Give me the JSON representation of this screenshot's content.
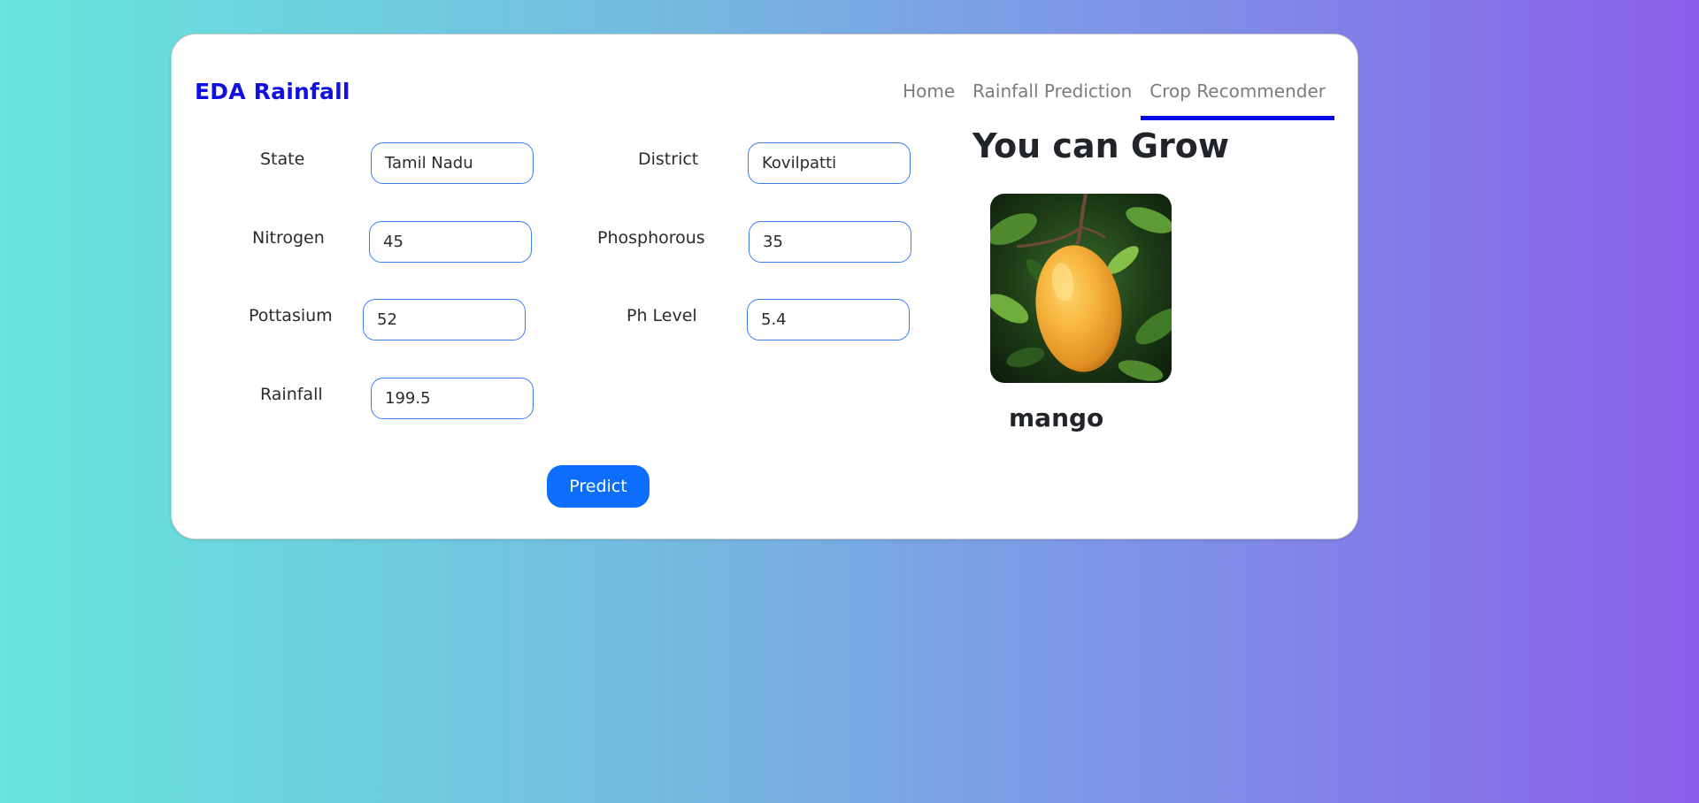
{
  "brand": "EDA Rainfall",
  "nav": {
    "items": [
      {
        "label": "Home"
      },
      {
        "label": "Rainfall Prediction"
      },
      {
        "label": "Crop Recommender"
      }
    ],
    "active": "Crop Recommender"
  },
  "form": {
    "state": {
      "label": "State",
      "value": "Tamil Nadu"
    },
    "district": {
      "label": "District",
      "value": "Kovilpatti"
    },
    "nitrogen": {
      "label": "Nitrogen",
      "value": "45"
    },
    "phosphorous": {
      "label": "Phosphorous",
      "value": "35"
    },
    "pottasium": {
      "label": "Pottasium",
      "value": "52"
    },
    "ph_level": {
      "label": "Ph Level",
      "value": "5.4"
    },
    "rainfall": {
      "label": "Rainfall",
      "value": "199.5"
    },
    "submit_label": "Predict"
  },
  "result": {
    "heading": "You can Grow",
    "crop": "mango",
    "image_icon": "mango-photo"
  },
  "colors": {
    "brand": "#1010e0",
    "active_underline": "#0808e6",
    "button": "#0d6efd",
    "input_border": "#3b7cf0"
  }
}
